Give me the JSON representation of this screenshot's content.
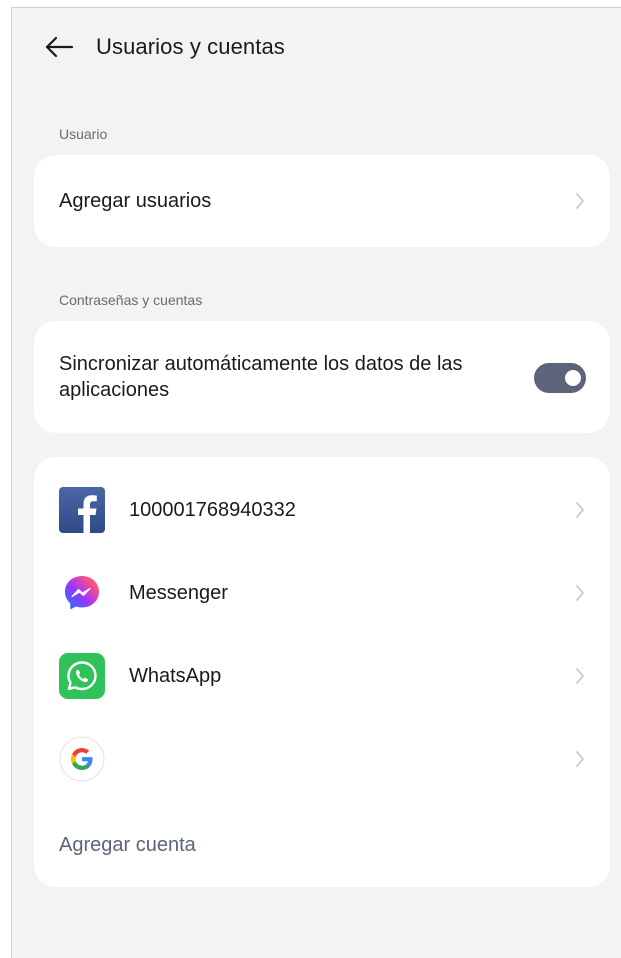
{
  "header": {
    "title": "Usuarios y cuentas"
  },
  "user_section": {
    "label": "Usuario",
    "add_users_label": "Agregar usuarios"
  },
  "passwords_section": {
    "label": "Contraseñas y cuentas",
    "sync_label": "Sincronizar automáticamente los datos de las aplicaciones",
    "sync_enabled": true
  },
  "accounts": {
    "items": [
      {
        "label": "100001768940332",
        "icon": "facebook-icon"
      },
      {
        "label": "Messenger",
        "icon": "messenger-icon"
      },
      {
        "label": "WhatsApp",
        "icon": "whatsapp-icon"
      },
      {
        "label": "",
        "icon": "google-icon"
      }
    ],
    "add_account_label": "Agregar cuenta"
  },
  "colors": {
    "background": "#f3f3f3",
    "card": "#ffffff",
    "toggle_on": "#5b6478",
    "link": "#5a6577",
    "facebook": "#3b5998",
    "whatsapp": "#25d366"
  }
}
